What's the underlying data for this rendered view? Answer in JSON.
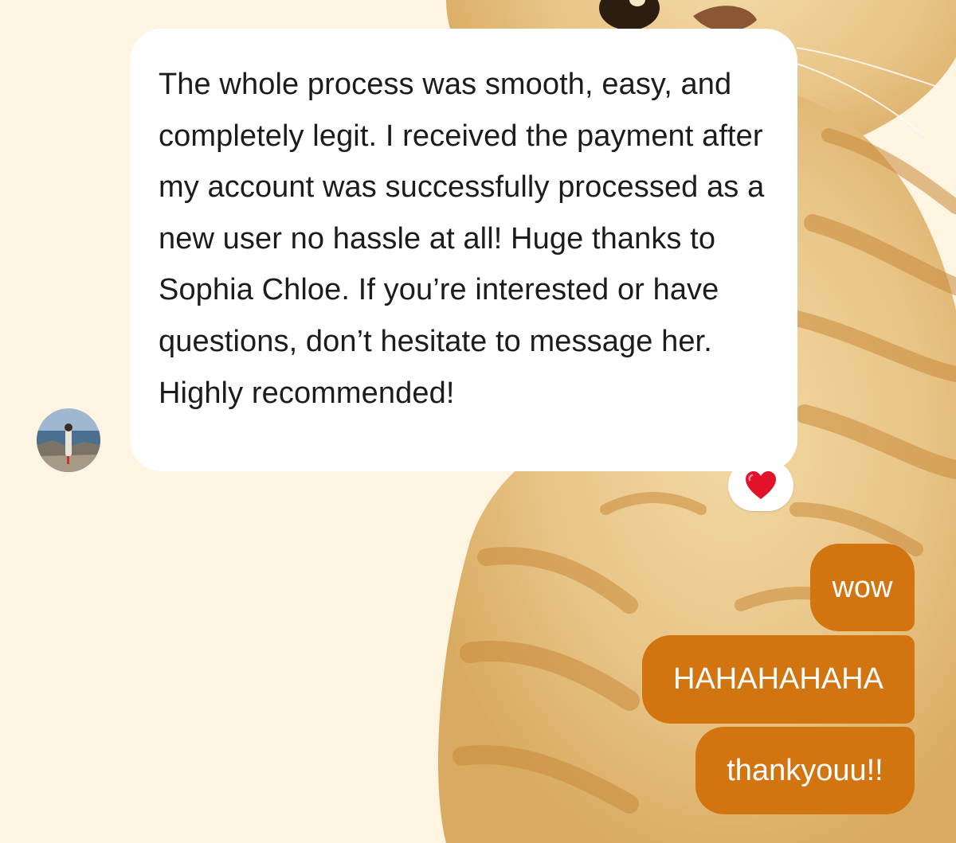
{
  "conversation": {
    "incoming_message": {
      "text": "The whole process was smooth, easy, and completely legit. I received the payment after my account was successfully processed as a new user no hassle at all! Huge thanks to Sophia Chloe. If you’re interested or have questions, don’t hesitate to message her. Highly recommended!",
      "reaction_icon": "red-heart-icon"
    },
    "sender_avatar_icon": "profile-photo-avatar",
    "outgoing_messages": [
      {
        "text": "wow"
      },
      {
        "text": "HAHAHAHAHA"
      },
      {
        "text": "thankyouu!!"
      }
    ]
  },
  "theme": {
    "background": "#fdf4e1",
    "incoming_bubble": "#ffffff",
    "outgoing_bubble": "#d27410",
    "reaction_heart": "#e3122b"
  }
}
